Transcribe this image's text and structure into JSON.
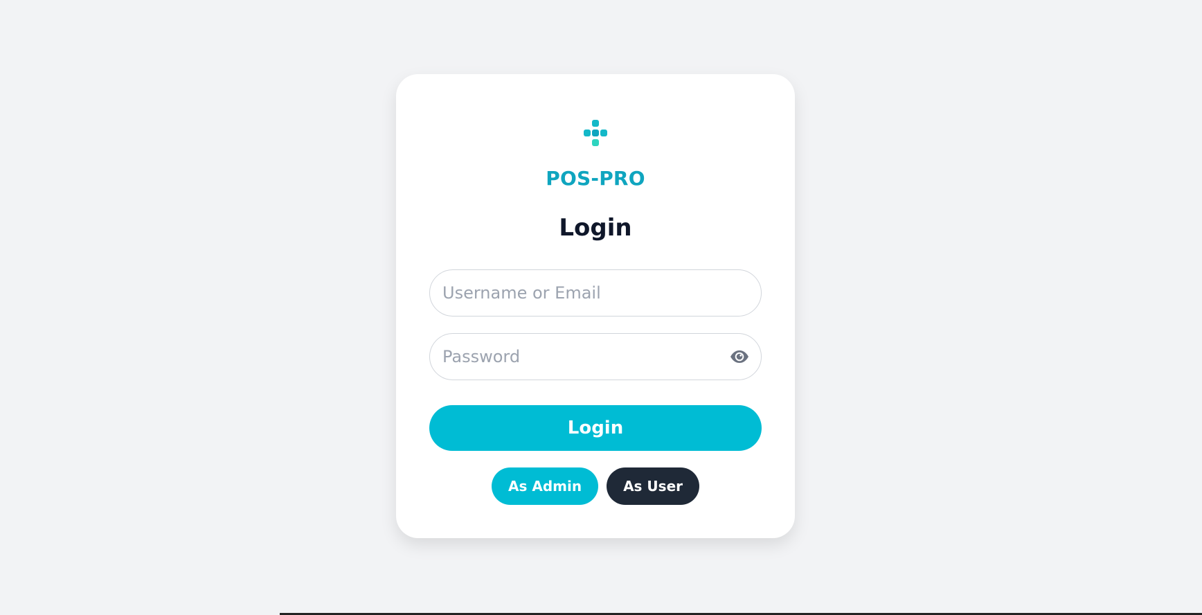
{
  "app": {
    "brand_name": "POS-PRO",
    "logo_icon": "dots-plus-icon",
    "accent_color": "#00bcd4",
    "brand_color": "#0fa5bf"
  },
  "login_form": {
    "title": "Login",
    "username_placeholder": "Username or Email",
    "password_placeholder": "Password",
    "password_toggle_icon": "eye-icon",
    "submit_label": "Login"
  },
  "role_buttons": {
    "admin_label": "As Admin",
    "user_label": "As User",
    "admin_color": "#00bcd4",
    "user_color": "#1f2937"
  }
}
